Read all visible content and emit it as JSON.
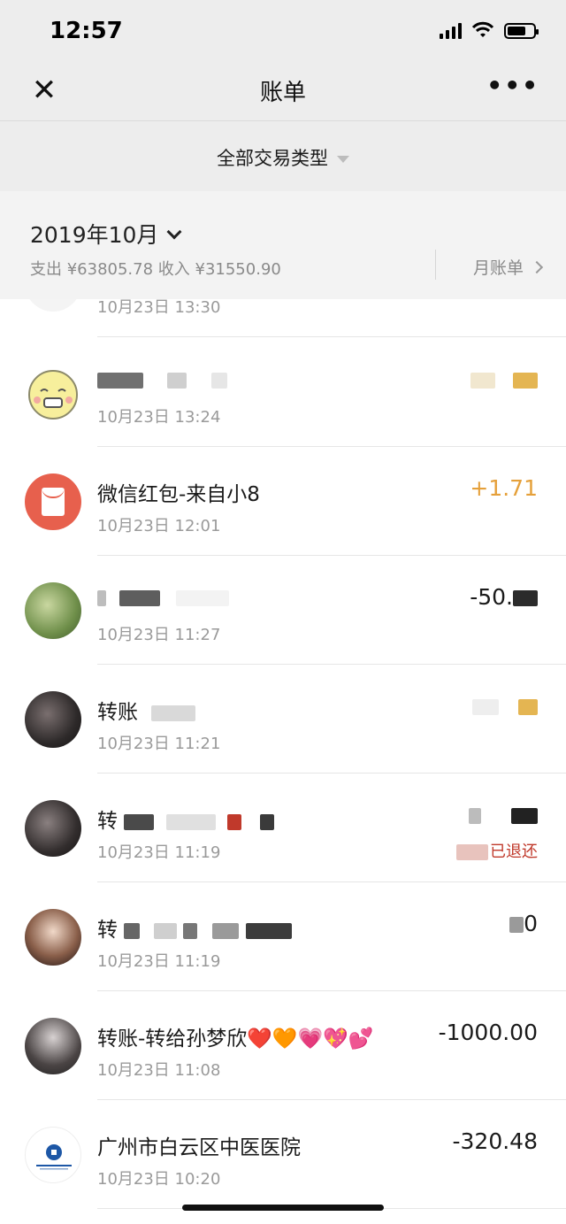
{
  "status_bar": {
    "time": "12:57",
    "battery_level": 0.7
  },
  "nav": {
    "title": "账单",
    "close_icon": "close-icon",
    "more_icon": "more-icon",
    "close_glyph": "✕",
    "more_glyph": "•••"
  },
  "filter": {
    "label": "全部交易类型"
  },
  "month": {
    "label": "2019年10月",
    "summary": "支出 ¥63805.78 收入 ¥31550.90",
    "monthly_bill_label": "月账单"
  },
  "transactions": [
    {
      "title": "",
      "time": "10月23日 13:30",
      "amount": "",
      "status": "",
      "avatar": "partial"
    },
    {
      "title": "",
      "time": "10月23日 13:24",
      "amount": "",
      "status": "",
      "avatar": "cartoon"
    },
    {
      "title": "微信红包-来自小8",
      "time": "10月23日 12:01",
      "amount": "+1.71",
      "status": "",
      "avatar": "red-packet"
    },
    {
      "title": "",
      "time": "10月23日 11:27",
      "amount": "-50.",
      "status": "",
      "avatar": "green"
    },
    {
      "title": "转账",
      "time": "10月23日 11:21",
      "amount": "",
      "status": "",
      "avatar": "dark"
    },
    {
      "title": "转",
      "time": "10月23日 11:19",
      "amount": "",
      "status": "已退还",
      "avatar": "dark"
    },
    {
      "title": "转",
      "time": "10月23日 11:19",
      "amount": "0",
      "status": "",
      "avatar": "girl"
    },
    {
      "title": "转账-转给孙梦欣❤️🧡💗💖💕",
      "time": "10月23日 11:08",
      "amount": "-1000.00",
      "status": "",
      "avatar": "dark2"
    },
    {
      "title": "广州市白云区中医医院",
      "time": "10月23日 10:20",
      "amount": "-320.48",
      "status": "",
      "avatar": "bank"
    }
  ]
}
